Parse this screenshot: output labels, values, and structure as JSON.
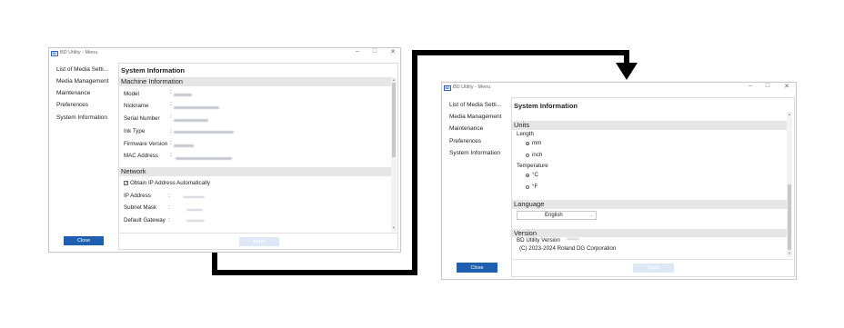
{
  "window1": {
    "title": "BD Utility - Menu",
    "icon_label": "BD",
    "controls": {
      "minimize": "–",
      "maximize": "□",
      "close": "✕"
    },
    "sidebar": [
      "List of Media Setti...",
      "Media Management",
      "Maintenance",
      "Preferences",
      "System Information"
    ],
    "page_title": "System Information",
    "machine_section": {
      "header": "Machine Information",
      "fields": [
        {
          "label": "Model",
          "sep": ":"
        },
        {
          "label": "Nickname",
          "sep": ":"
        },
        {
          "label": "Serial Number",
          "sep": ":"
        },
        {
          "label": "Ink Type",
          "sep": ":"
        },
        {
          "label": "Firmware Version",
          "sep": ":"
        },
        {
          "label": "MAC Address",
          "sep": ":"
        }
      ]
    },
    "network_section": {
      "header": "Network",
      "checkbox_label": "Obtain IP Address Automatically",
      "checkbox_checked": true,
      "fields": [
        {
          "label": "IP Address",
          "sep": ":"
        },
        {
          "label": "Subnet Mask",
          "sep": ":"
        },
        {
          "label": "Default Gateway",
          "sep": ":"
        }
      ]
    },
    "close_label": "Close",
    "apply_label": "Apply"
  },
  "window2": {
    "title": "BD Utility - Menu",
    "icon_label": "BD",
    "controls": {
      "minimize": "–",
      "maximize": "□",
      "close": "✕"
    },
    "sidebar": [
      "List of Media Setti...",
      "Media Management",
      "Maintenance",
      "Preferences",
      "System Information"
    ],
    "page_title": "System Information",
    "units_section": {
      "header": "Units",
      "length_label": "Length",
      "length_options": [
        "mm",
        "inch"
      ],
      "length_selected": "mm",
      "temperature_label": "Temperature",
      "temperature_options": [
        "°C",
        "°F"
      ],
      "temperature_selected": "°C"
    },
    "language_section": {
      "header": "Language",
      "selected": "English",
      "arrow": "⌄"
    },
    "version_section": {
      "header": "Version",
      "utility_version_label": "BD Utility Version",
      "copyright": "(C) 2023-2024 Roland DG Corporation"
    },
    "close_label": "Close",
    "apply_label": "Apply"
  },
  "colors": {
    "close_button": "#1f5faf",
    "apply_button_disabled": "#dce8f5",
    "section_band": "#e6e6e6",
    "connector": "#000000"
  }
}
